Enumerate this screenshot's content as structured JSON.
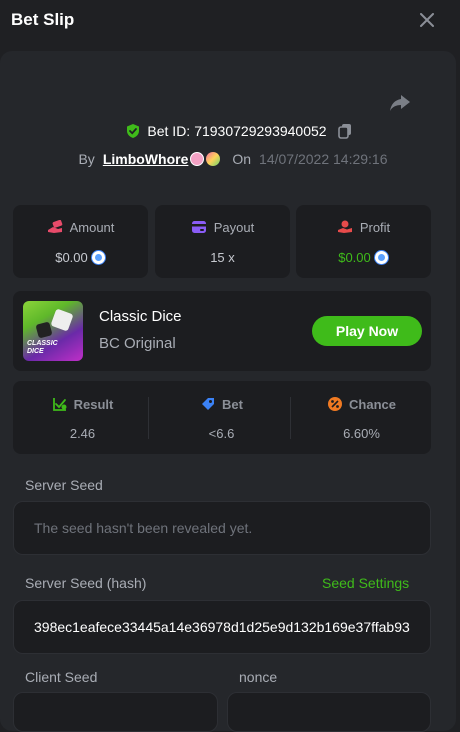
{
  "header": {
    "title": "Bet Slip"
  },
  "bet": {
    "id_label": "Bet ID:",
    "id": "71930729293940052",
    "by_label": "By",
    "user": "LimboWhore",
    "on_label": "On",
    "timestamp": "14/07/2022 14:29:16"
  },
  "stats": [
    {
      "label": "Amount",
      "value": "$0.00",
      "icon": "money-hand-icon",
      "color": "#e84b6a"
    },
    {
      "label": "Payout",
      "value": "15 x",
      "icon": "card-icon",
      "color": "#8a5cf6"
    },
    {
      "label": "Profit",
      "value": "$0.00",
      "icon": "profit-hand-icon",
      "color": "#e84b4b",
      "value_color": "#3fbb1a"
    }
  ],
  "game": {
    "name": "Classic Dice",
    "provider": "BC Original",
    "thumb_text_1": "CLASSIC",
    "thumb_text_2": "DICE",
    "play_label": "Play Now"
  },
  "metrics": [
    {
      "label": "Result",
      "value": "2.46",
      "icon": "chart-check-icon",
      "color": "#3fbb1a"
    },
    {
      "label": "Bet",
      "value": "<6.6",
      "icon": "tag-icon",
      "color": "#3b82f6"
    },
    {
      "label": "Chance",
      "value": "6.60%",
      "icon": "percent-icon",
      "color": "#f07a22"
    }
  ],
  "fairness": {
    "server_seed_label": "Server Seed",
    "server_seed_placeholder": "The seed hasn't been revealed yet.",
    "server_seed_hash_label": "Server Seed (hash)",
    "seed_settings_label": "Seed Settings",
    "server_seed_hash": "398ec1eafece33445a14e36978d1d25e9d132b169e37ffab93",
    "client_seed_label": "Client Seed",
    "nonce_label": "nonce"
  },
  "colors": {
    "accent": "#3fbb1a",
    "background": "#1f2023",
    "panel": "#25272b",
    "card": "#1c1d20"
  }
}
